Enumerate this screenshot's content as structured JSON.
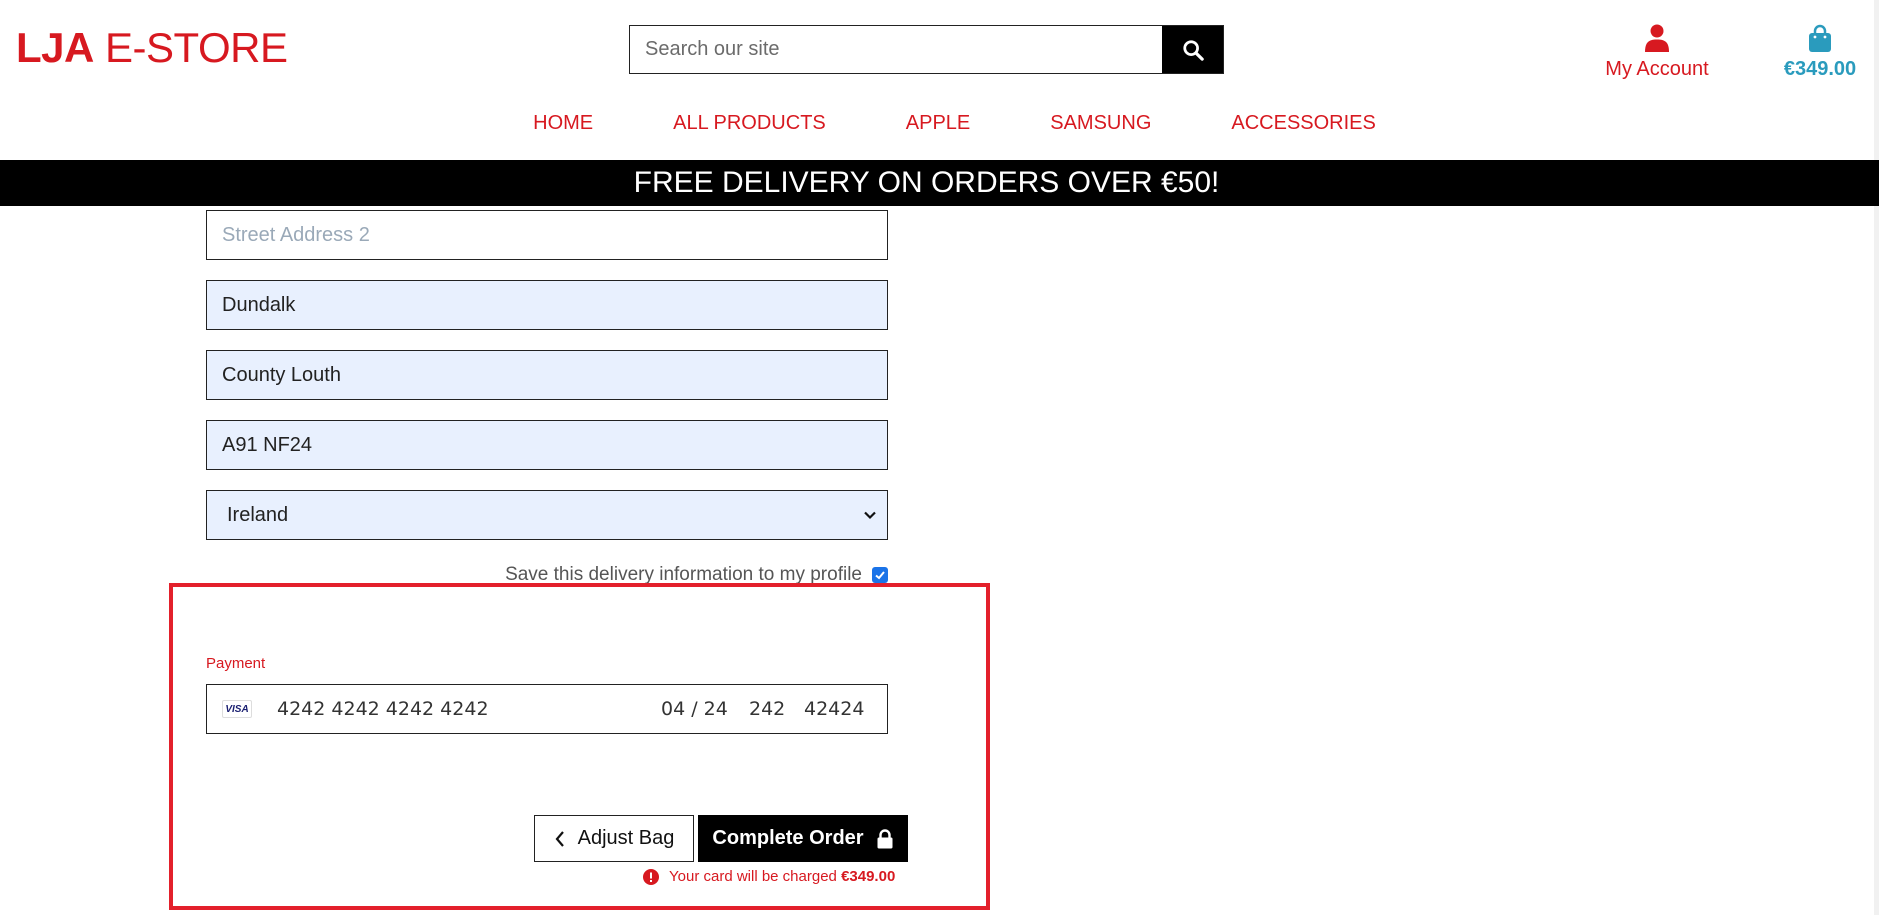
{
  "header": {
    "logo_strong": "LJA",
    "logo_rest": " E-STORE",
    "search_placeholder": "Search our site",
    "search_icon": "magnifier-icon",
    "account_label": "My Account",
    "bag_total": "€349.00"
  },
  "nav": [
    "HOME",
    "ALL PRODUCTS",
    "APPLE",
    "SAMSUNG",
    "ACCESSORIES"
  ],
  "banner": "FREE DELIVERY ON ORDERS OVER €50!",
  "form": {
    "street2_placeholder": "Street Address 2",
    "town": "Dundalk",
    "county": "County Louth",
    "postcode": "A91 NF24",
    "country": "Ireland",
    "save_label": "Save this delivery information to my profile",
    "save_checked": true
  },
  "payment": {
    "label": "Payment",
    "brand": "VISA",
    "card_number": "4242 4242 4242 4242",
    "expiry": "04 / 24",
    "cvc": "242",
    "postal": "42424"
  },
  "actions": {
    "adjust_label": "Adjust Bag",
    "complete_label": "Complete Order",
    "charge_text": "Your card will be charged",
    "charge_amount": "€349.00"
  },
  "colors": {
    "brand_red": "#d71920",
    "bag_teal": "#2a9bbd",
    "highlight": "#e3202b",
    "autofill": "#e8f0fe"
  }
}
